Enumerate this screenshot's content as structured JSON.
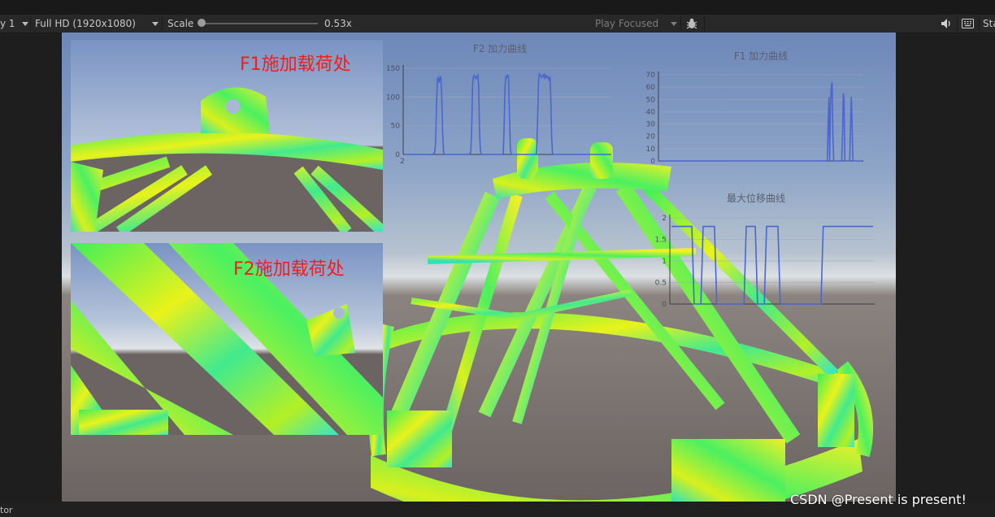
{
  "toolbar": {
    "display_fragment": "y 1",
    "resolution": "Full HD (1920x1080)",
    "scale_label": "Scale",
    "scale_value": "0.53x",
    "play_mode": "Play Focused",
    "stats_fragment": "Sta"
  },
  "insets": [
    {
      "label": "F1施加载荷处"
    },
    {
      "label": "F2施加载荷处"
    }
  ],
  "statusbar": {
    "fragment": "tor"
  },
  "watermark": "CSDN @Present is present!",
  "colors": {
    "chart_line": "#4a66cf",
    "label_red": "#f21d1d",
    "mesh_green": "#3ff05a",
    "mesh_yellow": "#eaf21a"
  },
  "chart_data": [
    {
      "type": "line",
      "title": "F2 加力曲线",
      "yticks": [
        "0",
        "50",
        "100",
        "150"
      ],
      "xticks": [
        "2"
      ],
      "ylim": [
        0,
        150
      ],
      "series": [
        {
          "values": [
            0,
            0,
            0,
            0,
            0,
            0,
            0,
            0,
            0,
            0,
            0,
            0,
            0,
            0,
            0,
            0,
            0,
            0,
            0,
            0,
            0,
            0,
            0,
            0,
            0,
            0,
            0,
            0,
            0,
            0,
            0,
            0,
            0,
            2,
            4,
            20,
            80,
            130,
            134,
            125,
            133,
            136,
            100,
            40,
            5,
            0,
            0,
            0,
            0,
            0,
            0,
            0,
            0,
            0,
            0,
            0,
            0,
            0,
            0,
            0,
            0,
            0,
            0,
            0,
            0,
            0,
            0,
            0,
            0,
            0,
            0,
            0,
            0,
            0,
            2,
            4,
            40,
            120,
            136,
            138,
            134,
            132,
            136,
            138,
            120,
            40,
            6,
            0,
            0,
            0,
            0,
            0,
            0,
            0,
            0,
            0,
            0,
            0,
            0,
            0,
            0,
            0,
            0,
            0,
            0,
            0,
            0,
            0,
            0,
            0,
            0,
            0,
            3,
            50,
            120,
            136,
            134,
            138,
            136,
            70,
            10,
            0,
            0,
            0,
            0,
            0,
            0,
            0,
            0,
            0,
            0,
            0,
            0,
            0,
            0,
            0,
            0,
            0,
            0,
            0,
            0,
            0,
            0,
            0,
            0,
            0,
            0,
            0,
            0,
            0,
            4,
            60,
            125,
            140,
            138,
            136,
            134,
            137,
            139,
            132,
            138,
            134,
            136,
            133,
            130,
            136,
            100,
            30,
            2,
            0,
            0,
            0,
            0,
            0,
            0,
            0,
            0,
            0,
            0,
            0,
            0,
            0,
            0,
            0,
            0,
            0,
            0,
            0,
            0,
            0,
            0,
            0,
            0,
            0,
            0,
            0,
            0,
            0,
            0,
            0,
            0,
            0,
            0,
            0,
            0,
            0,
            0,
            0,
            0,
            0,
            0,
            0,
            0,
            0,
            0,
            0,
            0,
            0,
            0,
            0,
            0,
            0,
            0,
            0,
            0,
            0,
            0,
            0,
            0,
            0,
            0,
            0,
            0,
            0
          ]
        }
      ]
    },
    {
      "type": "line",
      "title": "F1 加力曲线",
      "yticks": [
        "0",
        "10",
        "20",
        "30",
        "40",
        "50",
        "60",
        "70"
      ],
      "ylim": [
        0,
        70
      ],
      "series": [
        {
          "values": [
            0,
            0,
            0,
            0,
            0,
            0,
            0,
            0,
            0,
            0,
            0,
            0,
            0,
            0,
            0,
            0,
            0,
            0,
            0,
            0,
            0,
            0,
            0,
            0,
            0,
            0,
            0,
            0,
            0,
            0,
            0,
            0,
            0,
            0,
            0,
            0,
            0,
            0,
            0,
            0,
            0,
            0,
            0,
            0,
            0,
            0,
            0,
            0,
            0,
            0,
            0,
            0,
            0,
            0,
            0,
            0,
            0,
            0,
            0,
            0,
            0,
            0,
            0,
            0,
            0,
            0,
            0,
            0,
            0,
            0,
            0,
            0,
            0,
            0,
            0,
            0,
            0,
            0,
            0,
            0,
            0,
            0,
            0,
            0,
            0,
            0,
            0,
            0,
            0,
            0,
            0,
            0,
            0,
            0,
            0,
            0,
            0,
            0,
            0,
            0,
            0,
            0,
            0,
            0,
            0,
            0,
            0,
            0,
            0,
            0,
            0,
            0,
            0,
            0,
            0,
            0,
            0,
            0,
            0,
            0,
            0,
            0,
            0,
            0,
            0,
            0,
            0,
            0,
            0,
            0,
            0,
            0,
            0,
            0,
            0,
            0,
            0,
            0,
            0,
            0,
            0,
            0,
            0,
            0,
            0,
            0,
            0,
            0,
            0,
            0,
            0,
            0,
            0,
            0,
            0,
            0,
            0,
            0,
            0,
            0,
            0,
            0,
            0,
            0,
            0,
            0,
            0,
            0,
            0,
            0,
            0,
            0,
            0,
            0,
            0,
            0,
            0,
            0,
            0,
            0,
            0,
            0,
            0,
            0,
            0,
            0,
            0,
            0,
            0,
            0,
            0,
            0,
            0,
            0,
            0,
            0,
            0,
            0,
            0,
            0,
            0,
            0,
            0,
            0,
            0,
            0,
            0,
            0,
            0,
            0,
            30,
            52,
            0,
            45,
            60,
            64,
            20,
            0,
            0,
            0,
            0,
            0,
            0,
            0,
            0,
            0,
            0,
            0,
            20,
            55,
            50,
            0,
            0,
            0,
            0,
            0,
            0,
            0,
            25,
            52,
            30,
            0,
            0,
            0,
            0,
            0,
            0,
            0,
            0,
            0,
            0,
            0,
            0
          ]
        }
      ]
    },
    {
      "type": "line",
      "title": "最大位移曲线",
      "yticks": [
        "0",
        "0.5",
        "1",
        "1.5",
        "2"
      ],
      "ylim": [
        0,
        2
      ],
      "series": [
        {
          "values": [
            1.8,
            1.8,
            1.8,
            1.8,
            1.8,
            1.8,
            1.8,
            1.8,
            1.8,
            1.8,
            0,
            0,
            0,
            0,
            1.8,
            1.8,
            1.8,
            1.8,
            1.8,
            1.8,
            0,
            0,
            0,
            0,
            0,
            0,
            0,
            0,
            0,
            0,
            0,
            0,
            0,
            1.8,
            1.8,
            1.8,
            1.8,
            1.8,
            0,
            0,
            0,
            0,
            1.8,
            1.8,
            1.8,
            1.8,
            1.8,
            1.8,
            0,
            0,
            0,
            0,
            0,
            0,
            0,
            0,
            0,
            0,
            0,
            0,
            0,
            0,
            0,
            0,
            0,
            0,
            0,
            1.8,
            1.8,
            1.8,
            1.8,
            1.8,
            1.8,
            1.8,
            1.8,
            1.8,
            1.8,
            1.8,
            1.8,
            1.8,
            1.8,
            1.8,
            1.8,
            1.8,
            1.8,
            1.8,
            1.8,
            1.8,
            1.8,
            1.8
          ]
        }
      ]
    }
  ]
}
